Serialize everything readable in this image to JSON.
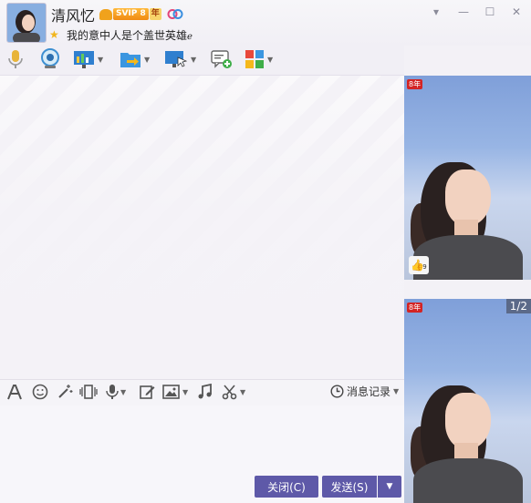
{
  "profile": {
    "nickname": "清风忆",
    "vip_label": "SVIP 8",
    "vip_year": "年",
    "signature": "我的意中人是个盖世英雄",
    "signature_suffix": "ℯ"
  },
  "window": {
    "controls": [
      "▾",
      "—",
      "☐",
      "✕"
    ]
  },
  "toolbar": {
    "icons": [
      "voice-call-icon",
      "video-call-icon",
      "remote-desktop-icon",
      "file-transfer-icon",
      "screen-share-icon",
      "new-message-icon",
      "apps-icon"
    ]
  },
  "input_toolbar": {
    "history_label": "消息记录"
  },
  "buttons": {
    "close": "关闭(C)",
    "send": "发送(S)"
  },
  "side": {
    "tag": "8年",
    "page_indicator": "1/2",
    "thumb_badge_number": "9"
  },
  "colors": {
    "accent": "#5e59a8",
    "vip": "#f08a12"
  }
}
